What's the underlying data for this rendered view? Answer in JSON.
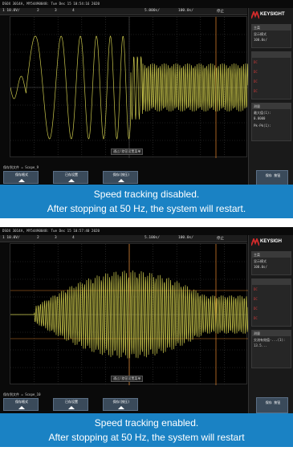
{
  "panels": [
    {
      "info": "DSOX 3014A, MY54490048: Tue Dec 15 10:54:16 2020",
      "topbar": [
        "1  10.0V/",
        "2",
        "3",
        "4",
        "5.000s/",
        "100.0s/",
        "停止"
      ],
      "sidebar_brand": "KEYSIGHT",
      "sidebar_rows": [
        "主菜",
        "显示模式",
        "100.0s/",
        "DC",
        "DC",
        "DC",
        "DC",
        "测量",
        "最大值(1):",
        "0.0000",
        "Pk-Pk(1):"
      ],
      "center_label": "通过/旋钮设置菜单",
      "softkey_label": "保存到文件 = Scope_9",
      "softkeys": [
        "保存格式",
        "已存设置",
        "保存(按压)"
      ],
      "softkey_right": "保存 按钮",
      "caption_line1": "Speed tracking disabled.",
      "caption_line2": "After stopping at 50 Hz, the system will restart."
    },
    {
      "info": "DSOX 3014A, MY54490048: Tue Dec 15 10:57:40 2020",
      "topbar": [
        "1  10.0V/",
        "2",
        "3",
        "4",
        "5.100s/",
        "100.0s/",
        "停止"
      ],
      "sidebar_brand": "KEYSIGH",
      "sidebar_rows": [
        "主菜",
        "显示模式",
        "100.0s/",
        "DC",
        "DC",
        "DC",
        "DC",
        "测量",
        "交流有效值-...(1):",
        "13.5..."
      ],
      "center_label": "通过/旋钮设置菜单",
      "softkey_label": "保存到文件 = Scope_10",
      "softkeys": [
        "保存格式",
        "已存设置",
        "保存(按压)"
      ],
      "softkey_right": "保存 按钮",
      "caption_line1": "Speed tracking enabled.",
      "caption_line2": "After stopping at 50 Hz, the system will restart"
    }
  ],
  "colors": {
    "trace": "#c9c64b",
    "grid": "#3a3a3a",
    "cursor_orange": "#d07a2a",
    "caption_bg": "#1a82c4"
  }
}
